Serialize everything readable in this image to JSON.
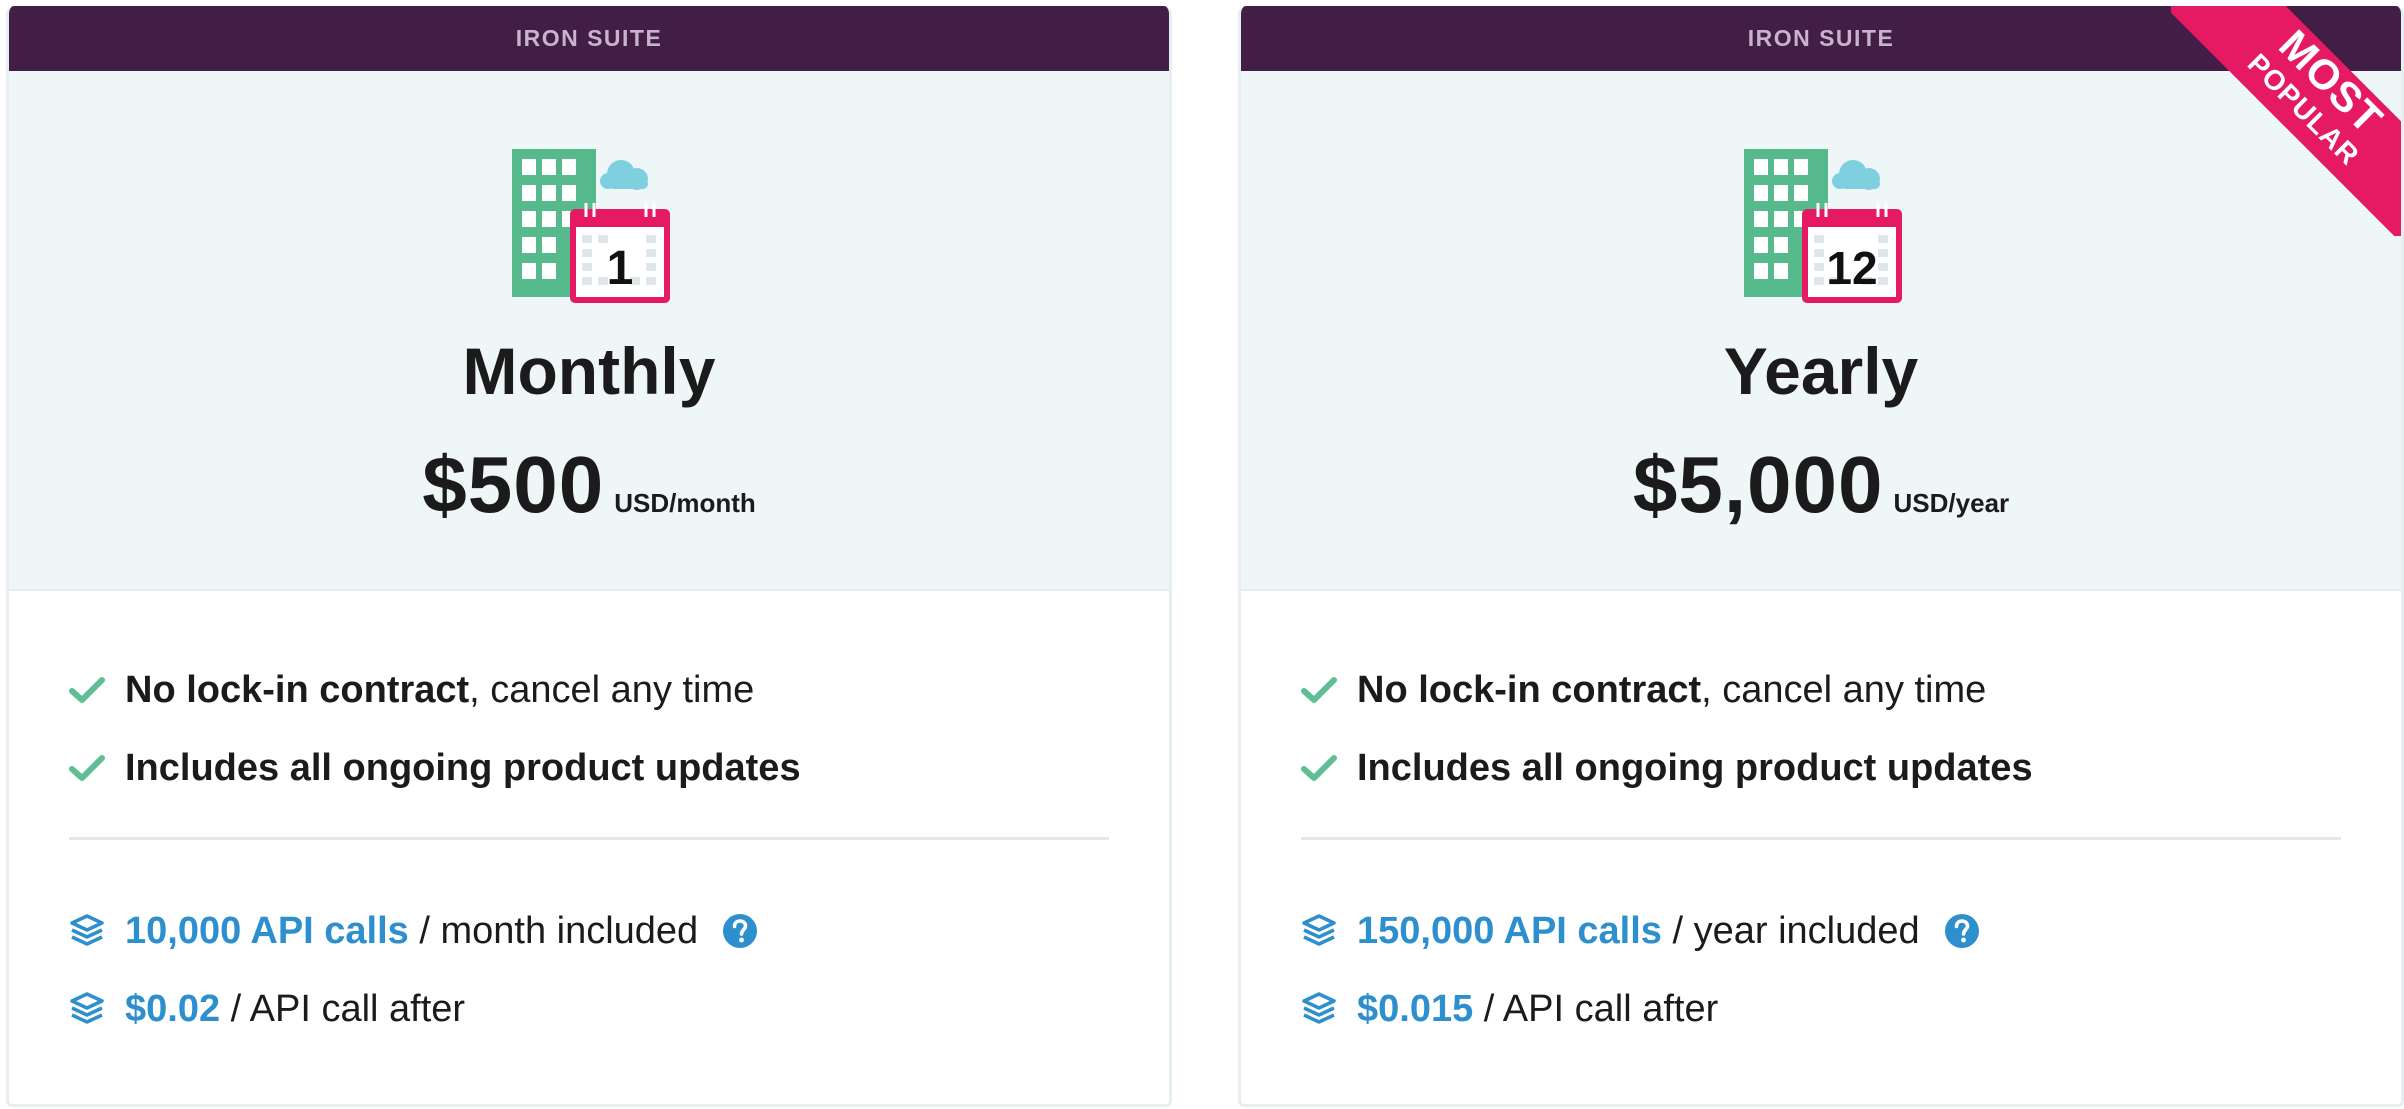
{
  "plans": [
    {
      "suite_label": "IRON SUITE",
      "calendar_number": "1",
      "name": "Monthly",
      "price": "$500",
      "price_unit": "USD/month",
      "features": [
        {
          "bold": "No lock-in contract",
          "rest": ", cancel any time"
        },
        {
          "bold": "Includes all ongoing product updates",
          "rest": ""
        }
      ],
      "api": {
        "included_amount": "10,000 API calls",
        "included_rest": " / month included",
        "overage_price": "$0.02",
        "overage_rest": " / API call after"
      }
    },
    {
      "suite_label": "IRON SUITE",
      "calendar_number": "12",
      "name": "Yearly",
      "price": "$5,000",
      "price_unit": "USD/year",
      "badge_line1": "MOST",
      "badge_line2": "POPULAR",
      "features": [
        {
          "bold": "No lock-in contract",
          "rest": ", cancel any time"
        },
        {
          "bold": "Includes all ongoing product updates",
          "rest": ""
        }
      ],
      "api": {
        "included_amount": "150,000 API calls",
        "included_rest": " / year included",
        "overage_price": "$0.015",
        "overage_rest": " / API call after"
      }
    }
  ],
  "colors": {
    "header_bar": "#421d45",
    "hero_background": "#eff6f8",
    "check_green": "#5fbf94",
    "link_blue": "#2d8fce",
    "badge_pink": "#e51a63",
    "calendar_pink": "#e51a63",
    "building_green": "#56b98c",
    "cloud_blue": "#7fd0de"
  },
  "icons": {
    "plan_icon": "building-calendar-icon",
    "check": "check-icon",
    "api": "layers-icon",
    "help": "question-circle-icon"
  }
}
